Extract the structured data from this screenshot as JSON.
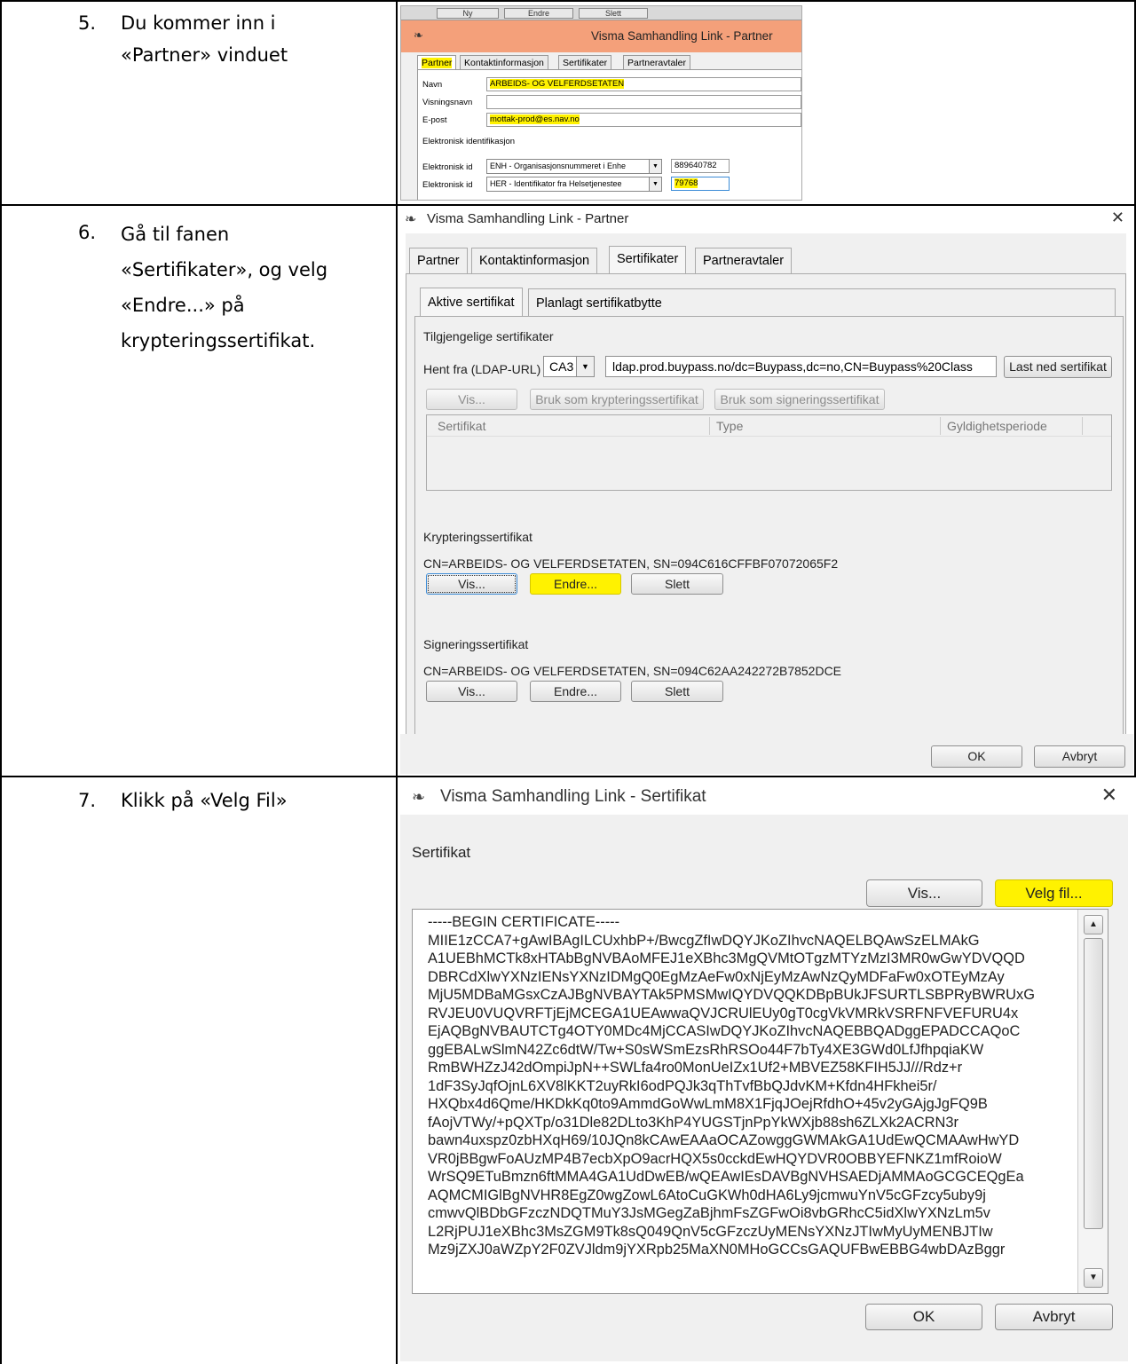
{
  "steps": [
    {
      "number": "5.",
      "text": "Du kommer inn i\n«Partner» vinduet"
    },
    {
      "number": "6.",
      "text": "Gå til fanen\n«Sertifikater», og velg\n«Endre...» på\nkrypteringssertifikat."
    },
    {
      "number": "7.",
      "text": "Klikk på «Velg Fil»"
    }
  ],
  "shot1": {
    "top_buttons": [
      "Ny",
      "Endre",
      "Slett"
    ],
    "title": "Visma Samhandling Link - Partner",
    "tabs": [
      "Partner",
      "Kontaktinformasjon",
      "Sertifikater",
      "Partneravtaler"
    ],
    "navn_label": "Navn",
    "navn_value": "ARBEIDS- OG VELFERDSETATEN",
    "visningsnavn_label": "Visningsnavn",
    "epost_label": "E-post",
    "epost_value": "mottak-prod@es.nav.no",
    "eid_heading": "Elektronisk identifikasjon",
    "eid1_label": "Elektronisk id",
    "eid1_type": "ENH - Organisasjonsnummeret i Enhe",
    "eid1_value": "889640782",
    "eid2_label": "Elektronisk id",
    "eid2_type": "HER - Identifikator fra Helsetjenestee",
    "eid2_value": "79768",
    "highlight_color": "#fff200"
  },
  "shot2": {
    "title": "Visma Samhandling Link - Partner",
    "tabs": [
      "Partner",
      "Kontaktinformasjon",
      "Sertifikater",
      "Partneravtaler"
    ],
    "subtabs": [
      "Aktive sertifikat",
      "Planlagt sertifikatbytte"
    ],
    "available_heading": "Tilgjengelige sertifikater",
    "hent_label": "Hent fra (LDAP-URL)",
    "hent_select": "CA3",
    "ldap_url": "ldap.prod.buypass.no/dc=Buypass,dc=no,CN=Buypass%20Class",
    "download_button": "Last ned sertifikat",
    "vis_button": "Vis...",
    "use_encrypt_button": "Bruk som krypteringssertifikat",
    "use_sign_button": "Bruk som signeringssertifikat",
    "columns": [
      "Sertifikat",
      "Type",
      "Gyldighetsperiode"
    ],
    "encrypt_heading": "Krypteringssertifikat",
    "encrypt_value": "CN=ARBEIDS- OG VELFERDSETATEN, SN=094C616CFFBF07072065F2",
    "sign_heading": "Signeringssertifikat",
    "sign_value": "CN=ARBEIDS- OG VELFERDSETATEN, SN=094C62AA242272B7852DCE",
    "vis_label": "Vis...",
    "endre_label": "Endre...",
    "slett_label": "Slett",
    "ok_label": "OK",
    "cancel_label": "Avbryt"
  },
  "shot3": {
    "title": "Visma Samhandling Link - Sertifikat",
    "cert_label": "Sertifikat",
    "vis_button": "Vis...",
    "choose_file_button": "Velg fil...",
    "cert_text": "-----BEGIN CERTIFICATE-----\nMIIE1zCCA7+gAwIBAgILCUxhbP+/BwcgZfIwDQYJKoZIhvcNAQELBQAwSzELMAkG\nA1UEBhMCTk8xHTAbBgNVBAoMFEJ1eXBhc3MgQVMtOTgzMTYzMzI3MR0wGwYDVQQD\nDBRCdXlwYXNzIENsYXNzIDMgQ0EgMzAeFw0xNjEyMzAwNzQyMDFaFw0xOTEyMzAy\nMjU5MDBaMGsxCzAJBgNVBAYTAk5PMSMwIQYDVQQKDBpBUkJFSURTLSBPRyBWRUxG\nRVJEU0VUQVRFTjEjMCEGA1UEAwwaQVJCRUlEUy0gT0cgVkVMRkVSRFNFVEFURU4x\nEjAQBgNVBAUTCTg4OTY0MDc4MjCCASIwDQYJKoZIhvcNAQEBBQADggEPADCCAQoC\nggEBALwSlmN42Zc6dtW/Tw+S0sWSmEzsRhRSOo44F7bTy4XE3GWd0LfJfhpqiaKW\nRmBWHZzJ42dOmpiJpN++SWLfa4ro0MonUeIZx1Uf2+MBVEZ58KFIH5JJ///Rdz+r\n1dF3SyJqfOjnL6XV8lKKT2uyRkI6odPQJk3qThTvfBbQJdvKM+Kfdn4HFkhei5r/\nHXQbx4d6Qme/HKDkKq0to9AmmdGoWwLmM8X1FjqJOejRfdhO+45v2yGAjgJgFQ9B\nfAojVTWy/+pQXTp/o31Dle82DLto3KhP4YUGSTjnPpYkWXjb88sh6ZLXk2ACRN3r\nbawn4uxspz0zbHXqH69/10JQn8kCAwEAAaOCAZowggGWMAkGA1UdEwQCMAAwHwYD\nVR0jBBgwFoAUzMP4B7ecbXpO9acrHQX5s0cckdEwHQYDVR0OBBYEFNKZ1mfRoioW\nWrSQ9ETuBmzn6ftMMA4GA1UdDwEB/wQEAwIEsDAVBgNVHSAEDjAMMAoGCGCEQgEa\nAQMCMIGlBgNVHR8EgZ0wgZowL6AtoCuGKWh0dHA6Ly9jcmwuYnV5cGFzcy5uby9j\ncmwvQlBDbGFzczNDQTMuY3JsMGegZaBjhmFsZGFwOi8vbGRhcC5idXlwYXNzLm5v\nL2RjPUJ1eXBhc3MsZGM9Tk8sQ049QnV5cGFzczUyMENsYXNzJTIwMyUyMENBJTIw\nMz9jZXJ0aWZpY2F0ZVJldm9jYXRpb25MaXN0MHoGCCsGAQUFBwEBBG4wbDAzBggr",
    "ok_label": "OK",
    "cancel_label": "Avbryt"
  }
}
